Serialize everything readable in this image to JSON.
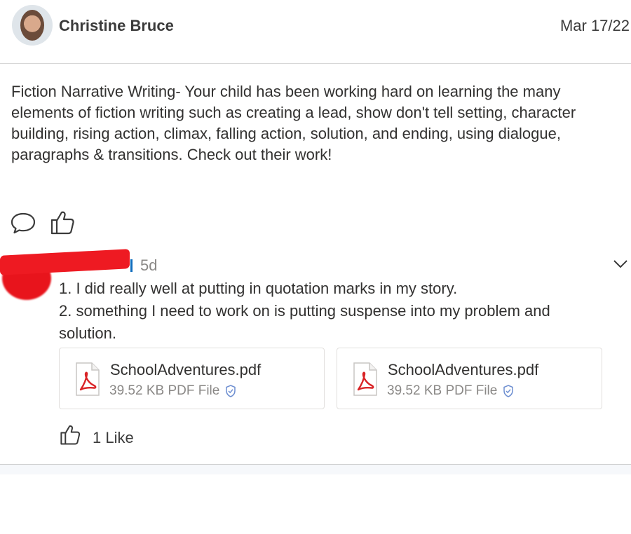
{
  "post": {
    "author": "Christine Bruce",
    "date": "Mar 17/22",
    "body": "Fiction Narrative Writing- Your child has been working hard on learning the many elements of fiction writing such as creating a lead, show don't tell setting, character building, rising action, climax, falling action, solution, and ending, using dialogue, paragraphs & transitions. Check out their work!"
  },
  "actions": {
    "comment_icon": "speech-bubble-icon",
    "like_icon": "thumbs-up-icon"
  },
  "comment": {
    "time": "5d",
    "lines": [
      "1. I did really well at putting in quotation marks in my story.",
      "2. something I need to work on is putting suspense into my problem and solution."
    ],
    "attachments": [
      {
        "name": "SchoolAdventures.pdf",
        "size": "39.52 KB",
        "type": "PDF File"
      },
      {
        "name": "SchoolAdventures.pdf",
        "size": "39.52 KB",
        "type": "PDF File"
      }
    ],
    "likes": "1 Like"
  },
  "colors": {
    "pdf_red": "#d92326",
    "redaction": "#ee1a22",
    "link_blue": "#0f6cbd",
    "muted_text": "#8a8886",
    "shield_blue": "#6e8fd1"
  }
}
